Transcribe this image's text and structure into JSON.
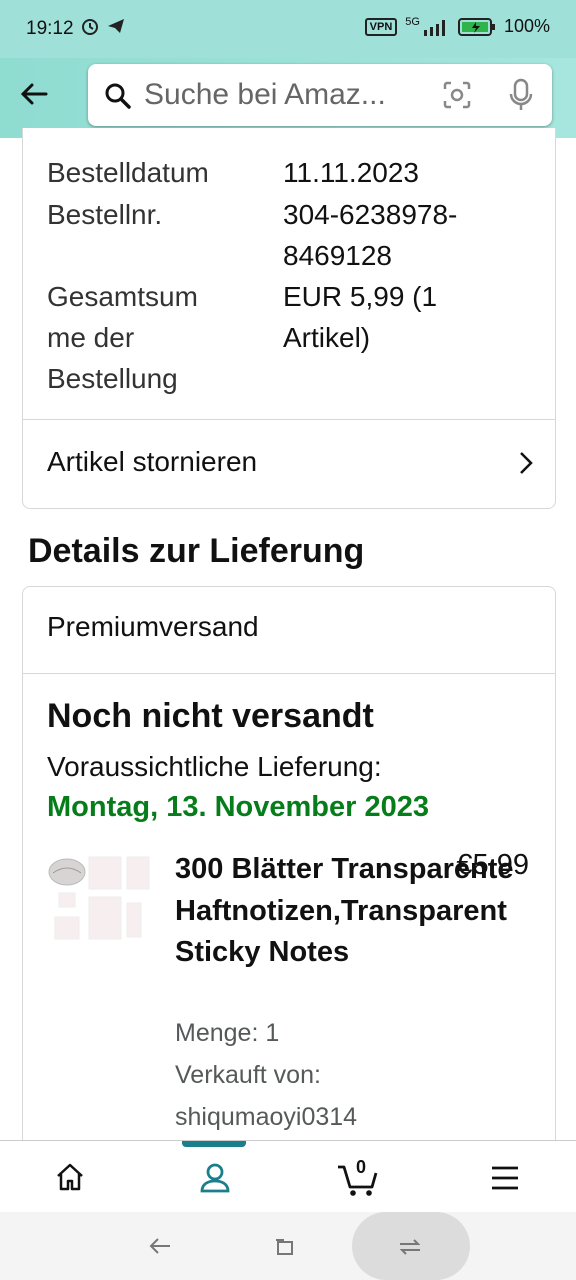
{
  "status": {
    "time": "19:12",
    "vpn": "VPN",
    "network": "5G",
    "battery": "100%"
  },
  "search": {
    "placeholder": "Suche bei Amaz..."
  },
  "order": {
    "rows": [
      {
        "label": "Bestelldatum",
        "value": "11.11.2023"
      },
      {
        "label": "Bestellnr.",
        "value": "304-6238978-\n8469128"
      },
      {
        "label": "Gesamtsum\nme der\nBestellung",
        "value": "EUR 5,99 (1\nArtikel)"
      }
    ],
    "cancel_label": "Artikel stornieren"
  },
  "delivery": {
    "heading": "Details zur Lieferung",
    "shipping_method": "Premiumversand",
    "status": "Noch nicht versandt",
    "expected_label": "Voraussichtliche Lieferung:",
    "expected_date": "Montag, 13. November 2023",
    "item": {
      "title": "300 Blätter Transparente Haftnotizen,Transparent Sticky Notes",
      "price": "€5,99",
      "quantity": "Menge: 1",
      "sold_by_label": "Verkauft von:",
      "seller": "shiqumaoyi0314"
    }
  },
  "nav": {
    "cart_count": "0"
  },
  "colors": {
    "accent": "#1b7e8b",
    "delivery_green": "#067d1a",
    "header": "#9fe0d8"
  }
}
